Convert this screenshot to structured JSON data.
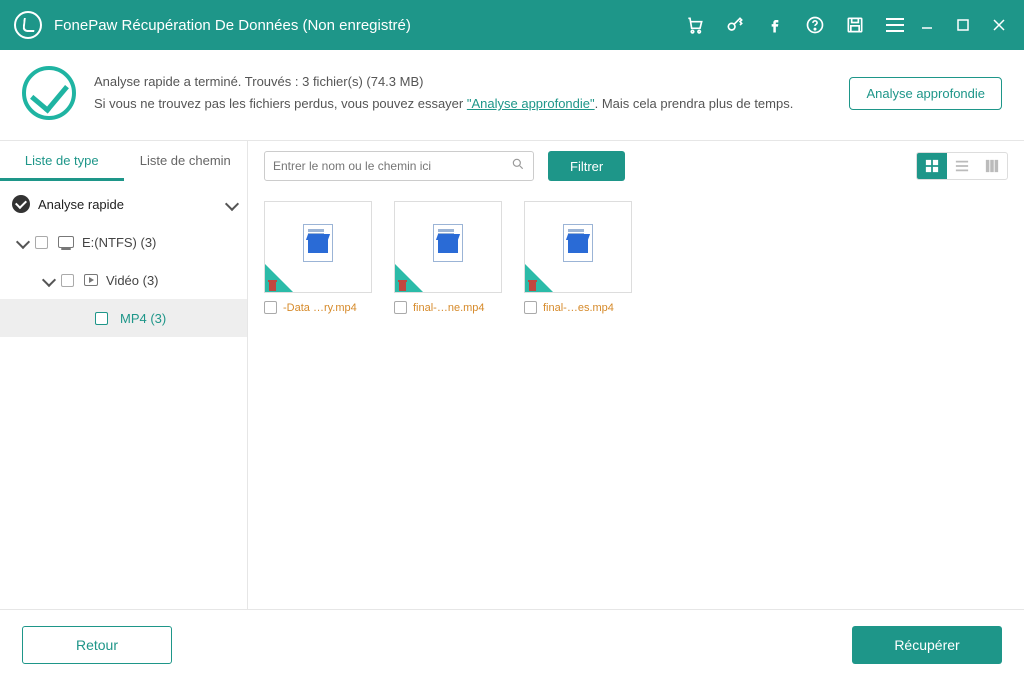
{
  "app_title": "FonePaw Récupération De Données (Non enregistré)",
  "status": {
    "line1": "Analyse rapide a terminé. Trouvés : 3 fichier(s) (74.3 MB)",
    "line2_a": "Si vous ne trouvez pas les fichiers perdus, vous pouvez essayer ",
    "link": "\"Analyse approfondie\"",
    "line2_b": ". Mais cela prendra plus de temps.",
    "deep_button": "Analyse approfondie"
  },
  "sidebar": {
    "tab_type": "Liste de type",
    "tab_path": "Liste de chemin",
    "quick_scan_label": "Analyse rapide",
    "drive_label": "E:(NTFS) (3)",
    "video_label": "Vidéo (3)",
    "mp4_label": "MP4 (3)"
  },
  "toolbar": {
    "search_placeholder": "Entrer le nom ou le chemin ici",
    "filter_label": "Filtrer"
  },
  "files": [
    {
      "name": "-Data …ry.mp4"
    },
    {
      "name": "final-…ne.mp4"
    },
    {
      "name": "final-…es.mp4"
    }
  ],
  "footer": {
    "back": "Retour",
    "recover": "Récupérer"
  }
}
